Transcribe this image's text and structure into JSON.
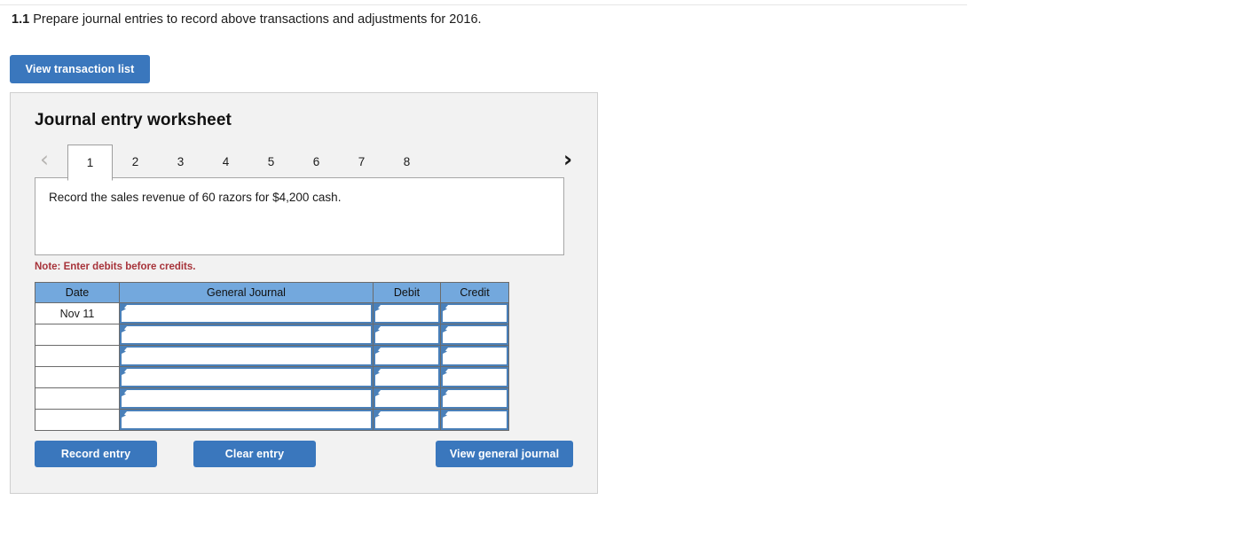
{
  "question": {
    "number": "1.1",
    "text": "Prepare journal entries to record above transactions and adjustments for 2016."
  },
  "toolbar": {
    "view_transaction_list_label": "View transaction list"
  },
  "worksheet": {
    "title": "Journal entry worksheet",
    "prev_icon": "‹",
    "next_icon": "›",
    "tabs": [
      {
        "label": "1",
        "active": true
      },
      {
        "label": "2",
        "active": false
      },
      {
        "label": "3",
        "active": false
      },
      {
        "label": "4",
        "active": false
      },
      {
        "label": "5",
        "active": false
      },
      {
        "label": "6",
        "active": false
      },
      {
        "label": "7",
        "active": false
      },
      {
        "label": "8",
        "active": false
      }
    ],
    "instruction": "Record the sales revenue of 60 razors for $4,200 cash.",
    "note": "Note: Enter debits before credits.",
    "table": {
      "headers": [
        "Date",
        "General Journal",
        "Debit",
        "Credit"
      ],
      "rows": [
        {
          "date": "Nov 11",
          "general_journal": "",
          "debit": "",
          "credit": ""
        },
        {
          "date": "",
          "general_journal": "",
          "debit": "",
          "credit": ""
        },
        {
          "date": "",
          "general_journal": "",
          "debit": "",
          "credit": ""
        },
        {
          "date": "",
          "general_journal": "",
          "debit": "",
          "credit": ""
        },
        {
          "date": "",
          "general_journal": "",
          "debit": "",
          "credit": ""
        },
        {
          "date": "",
          "general_journal": "",
          "debit": "",
          "credit": ""
        }
      ]
    },
    "actions": {
      "record_entry_label": "Record entry",
      "clear_entry_label": "Clear entry",
      "view_general_journal_label": "View general journal"
    }
  },
  "colors": {
    "primary_button": "#3a77bd",
    "table_header": "#73a8dd",
    "input_border": "#4a80b9",
    "note_text": "#a7333a",
    "panel_background": "#f2f2f2"
  }
}
